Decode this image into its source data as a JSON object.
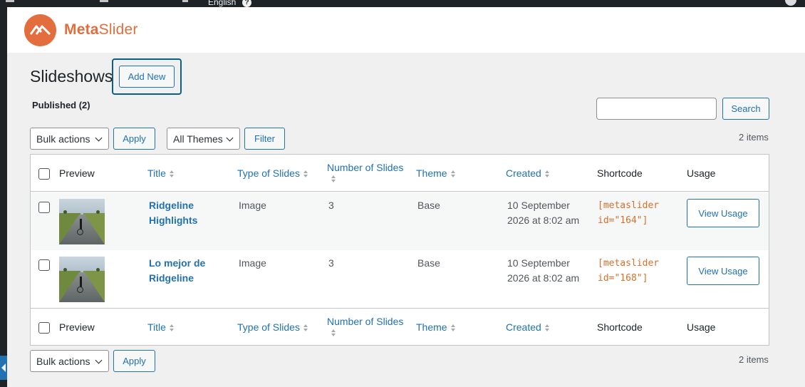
{
  "topbar": {
    "language_label": "English",
    "help_label": "?"
  },
  "brand": {
    "meta": "Meta",
    "slider": "Slider",
    "accent_color": "#e36d3d"
  },
  "page": {
    "title": "Slideshows",
    "add_new_label": "Add New"
  },
  "filters": {
    "published_label": "Published (2)",
    "search_value": "",
    "search_button_label": "Search",
    "bulk_actions_label": "Bulk actions",
    "apply_label": "Apply",
    "themes_label": "All Themes",
    "filter_label": "Filter",
    "items_count": "2 items"
  },
  "table": {
    "columns": {
      "preview": "Preview",
      "title": "Title",
      "type": "Type of Slides",
      "number": "Number of Slides",
      "theme": "Theme",
      "created": "Created",
      "shortcode": "Shortcode",
      "usage": "Usage"
    },
    "rows": [
      {
        "title_line1": "Ridgeline",
        "title_line2": "Highlights",
        "type": "Image",
        "slides": "3",
        "theme": "Base",
        "created_line1": "10 September",
        "created_line2": "2026 at 8:02 am",
        "shortcode_line1": "[metaslider",
        "shortcode_line2": "id=\"164\"]",
        "usage_label": "View Usage"
      },
      {
        "title_line1": "Lo mejor de",
        "title_line2": "Ridgeline",
        "type": "Image",
        "slides": "3",
        "theme": "Base",
        "created_line1": "10 September",
        "created_line2": "2026 at 8:02 am",
        "shortcode_line1": "[metaslider",
        "shortcode_line2": "id=\"168\"]",
        "usage_label": "View Usage"
      }
    ]
  },
  "bottom": {
    "bulk_actions_label": "Bulk actions",
    "apply_label": "Apply",
    "items_count": "2 items"
  }
}
